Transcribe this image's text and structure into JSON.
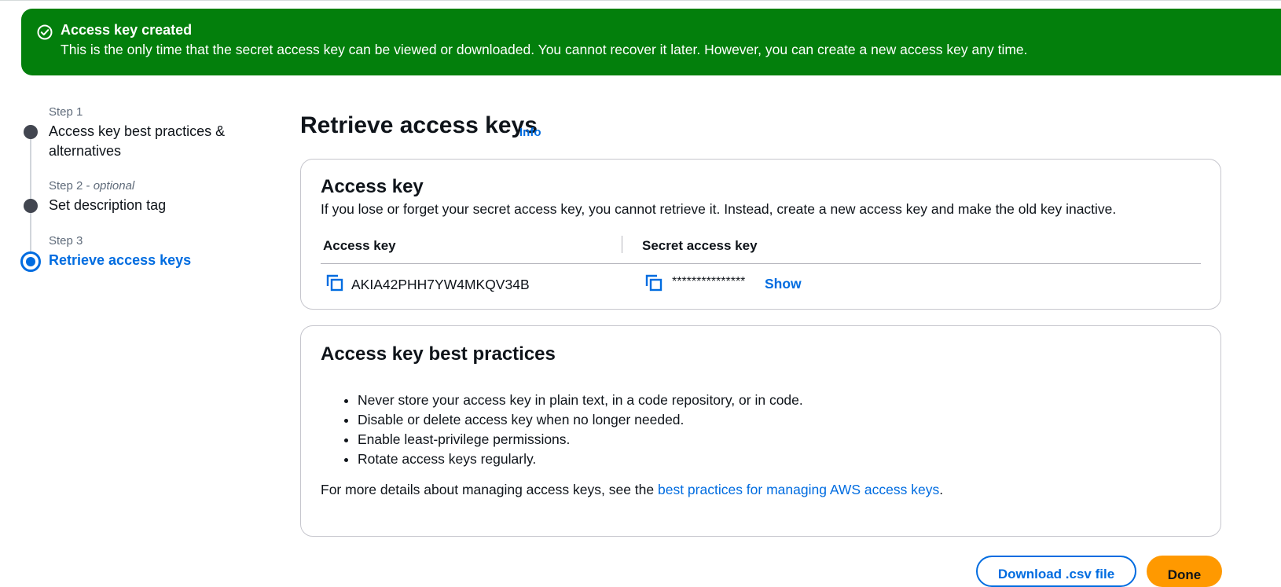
{
  "flash": {
    "icon": "check-circle-icon",
    "title": "Access key created",
    "message": "This is the only time that the secret access key can be viewed or downloaded. You cannot recover it later. However, you can create a new access key any time.",
    "color": "#037f0c"
  },
  "steps": [
    {
      "number": "Step 1",
      "optional": "",
      "title": "Access key best practices & alternatives",
      "state": "completed"
    },
    {
      "number": "Step 2",
      "optional": "optional",
      "title": "Set description tag",
      "state": "completed"
    },
    {
      "number": "Step 3",
      "optional": "",
      "title": "Retrieve access keys",
      "state": "active"
    }
  ],
  "page": {
    "title": "Retrieve access keys",
    "info_label": "Info"
  },
  "access_key_card": {
    "title": "Access key",
    "description": "If you lose or forget your secret access key, you cannot retrieve it. Instead, create a new access key and make the old key inactive.",
    "columns": [
      "Access key",
      "Secret access key"
    ],
    "access_key_value": "AKIA42PHH7YW4MKQV34B",
    "secret_masked": "***************",
    "show_label": "Show"
  },
  "best_practices_card": {
    "title": "Access key best practices",
    "items": [
      "Never store your access key in plain text, in a code repository, or in code.",
      "Disable or delete access key when no longer needed.",
      "Enable least-privilege permissions.",
      "Rotate access keys regularly."
    ],
    "footer_prefix": "For more details about managing access keys, see the ",
    "footer_link": "best practices for managing AWS access keys",
    "footer_suffix": "."
  },
  "actions": {
    "download_label": "Download .csv file",
    "done_label": "Done"
  },
  "colors": {
    "accent": "#006ce0",
    "primary_button": "#ff9900",
    "success": "#037f0c"
  }
}
